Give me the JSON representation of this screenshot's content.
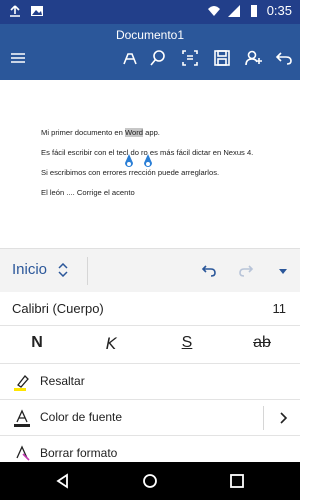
{
  "status_bar": {
    "time": "0:35",
    "left_icons": [
      "upload-icon",
      "image-icon"
    ],
    "right_icons": [
      "wifi-icon",
      "signal-icon",
      "battery-icon"
    ]
  },
  "title_bar": {
    "title": "Documento1",
    "icons": [
      "menu-icon",
      "pen-icon",
      "search-icon",
      "reading-mode-icon",
      "save-icon",
      "share-icon",
      "undo-icon"
    ]
  },
  "document": {
    "line1_before": "Mi primer documento en ",
    "line1_selected": "Word",
    "line1_after": " app.",
    "line2": "Es fácil escribir con el tecl  do     ro es más fácil dictar en Nexus 4.",
    "line3": "Si escribimos con errores       rrección puede arreglarlos.",
    "line4": "El león .... Corrige el acento"
  },
  "ribbon": {
    "tab_label": "Inicio",
    "icons": [
      "chevron-updown-icon",
      "undo-icon",
      "redo-icon",
      "dropdown-icon"
    ]
  },
  "font": {
    "name": "Calibri (Cuerpo)",
    "size": "11"
  },
  "format_buttons": {
    "bold": "N",
    "italic": "K",
    "underline": "S",
    "strikethrough": "ab"
  },
  "rows": {
    "highlight_label": "Resaltar",
    "font_color_label": "Color de fuente",
    "clear_format_label": "Borrar formato"
  },
  "colors": {
    "status_bar": "#223f8a",
    "title_bar": "#2b579a",
    "accent": "#2b579a",
    "highlight_yellow": "#ffe600"
  },
  "nav_bar": {
    "icons": [
      "back-icon",
      "home-icon",
      "recents-icon"
    ]
  }
}
